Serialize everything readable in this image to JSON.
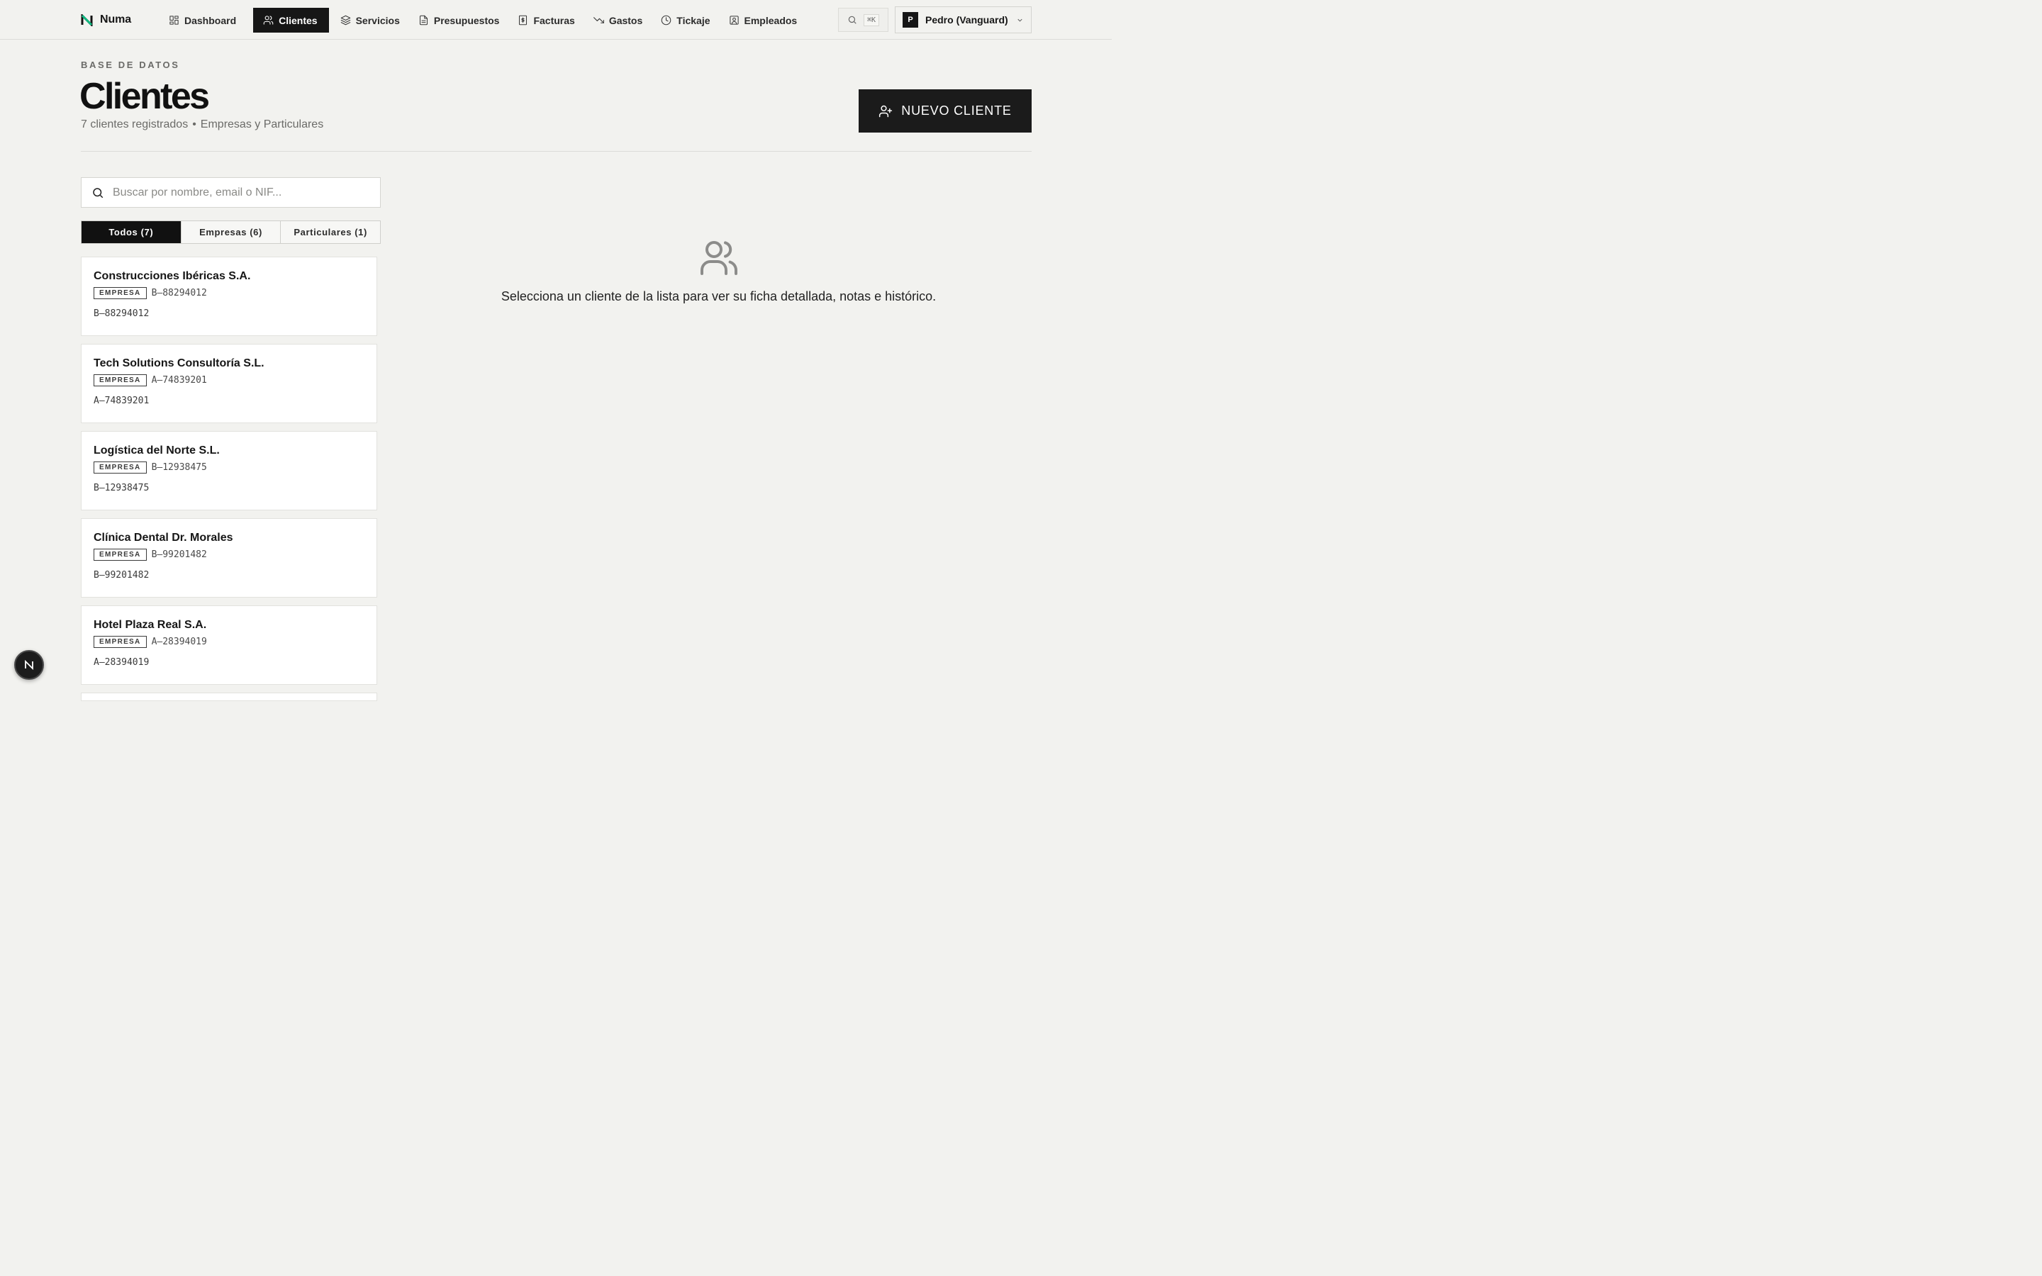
{
  "brand": {
    "name": "Numa",
    "accent": "#10b981",
    "icon": "n-logo-icon"
  },
  "nav": {
    "items": [
      {
        "label": "Dashboard",
        "icon": "grid-icon",
        "active": false
      },
      {
        "label": "Clientes",
        "icon": "users-icon",
        "active": true
      },
      {
        "label": "Servicios",
        "icon": "layers-icon",
        "active": false
      },
      {
        "label": "Presupuestos",
        "icon": "file-text-icon",
        "active": false
      },
      {
        "label": "Facturas",
        "icon": "receipt-icon",
        "active": false
      },
      {
        "label": "Gastos",
        "icon": "trending-down-icon",
        "active": false
      },
      {
        "label": "Tickaje",
        "icon": "clock-icon",
        "active": false
      },
      {
        "label": "Empleados",
        "icon": "id-badge-icon",
        "active": false
      }
    ],
    "search_shortcut": "⌘K"
  },
  "user": {
    "initial": "P",
    "name": "Pedro (Vanguard)"
  },
  "header": {
    "eyebrow": "BASE DE DATOS",
    "title": "Clientes",
    "count_text": "7 clientes registrados",
    "separator": "•",
    "types_text": "Empresas y Particulares",
    "new_button": "NUEVO CLIENTE"
  },
  "search": {
    "placeholder": "Buscar por nombre, email o NIF...",
    "value": ""
  },
  "filters": [
    {
      "label": "Todos (7)",
      "active": true
    },
    {
      "label": "Empresas (6)",
      "active": false
    },
    {
      "label": "Particulares (1)",
      "active": false
    }
  ],
  "clients": [
    {
      "name": "Construcciones Ibéricas S.A.",
      "type": "EMPRESA",
      "nif": "B–88294012",
      "nif_line": "B–88294012"
    },
    {
      "name": "Tech Solutions Consultoría S.L.",
      "type": "EMPRESA",
      "nif": "A–74839201",
      "nif_line": "A–74839201"
    },
    {
      "name": "Logística del Norte S.L.",
      "type": "EMPRESA",
      "nif": "B–12938475",
      "nif_line": "B–12938475"
    },
    {
      "name": "Clínica Dental Dr. Morales",
      "type": "EMPRESA",
      "nif": "B–99201482",
      "nif_line": "B–99201482"
    },
    {
      "name": "Hotel Plaza Real S.A.",
      "type": "EMPRESA",
      "nif": "A–28394019",
      "nif_line": "A–28394019"
    }
  ],
  "empty_state": {
    "icon": "users-icon",
    "message": "Selecciona un cliente de la lista para ver su ficha detallada, notas e histórico."
  },
  "dev_badge": {
    "icon": "n-logo-icon"
  }
}
